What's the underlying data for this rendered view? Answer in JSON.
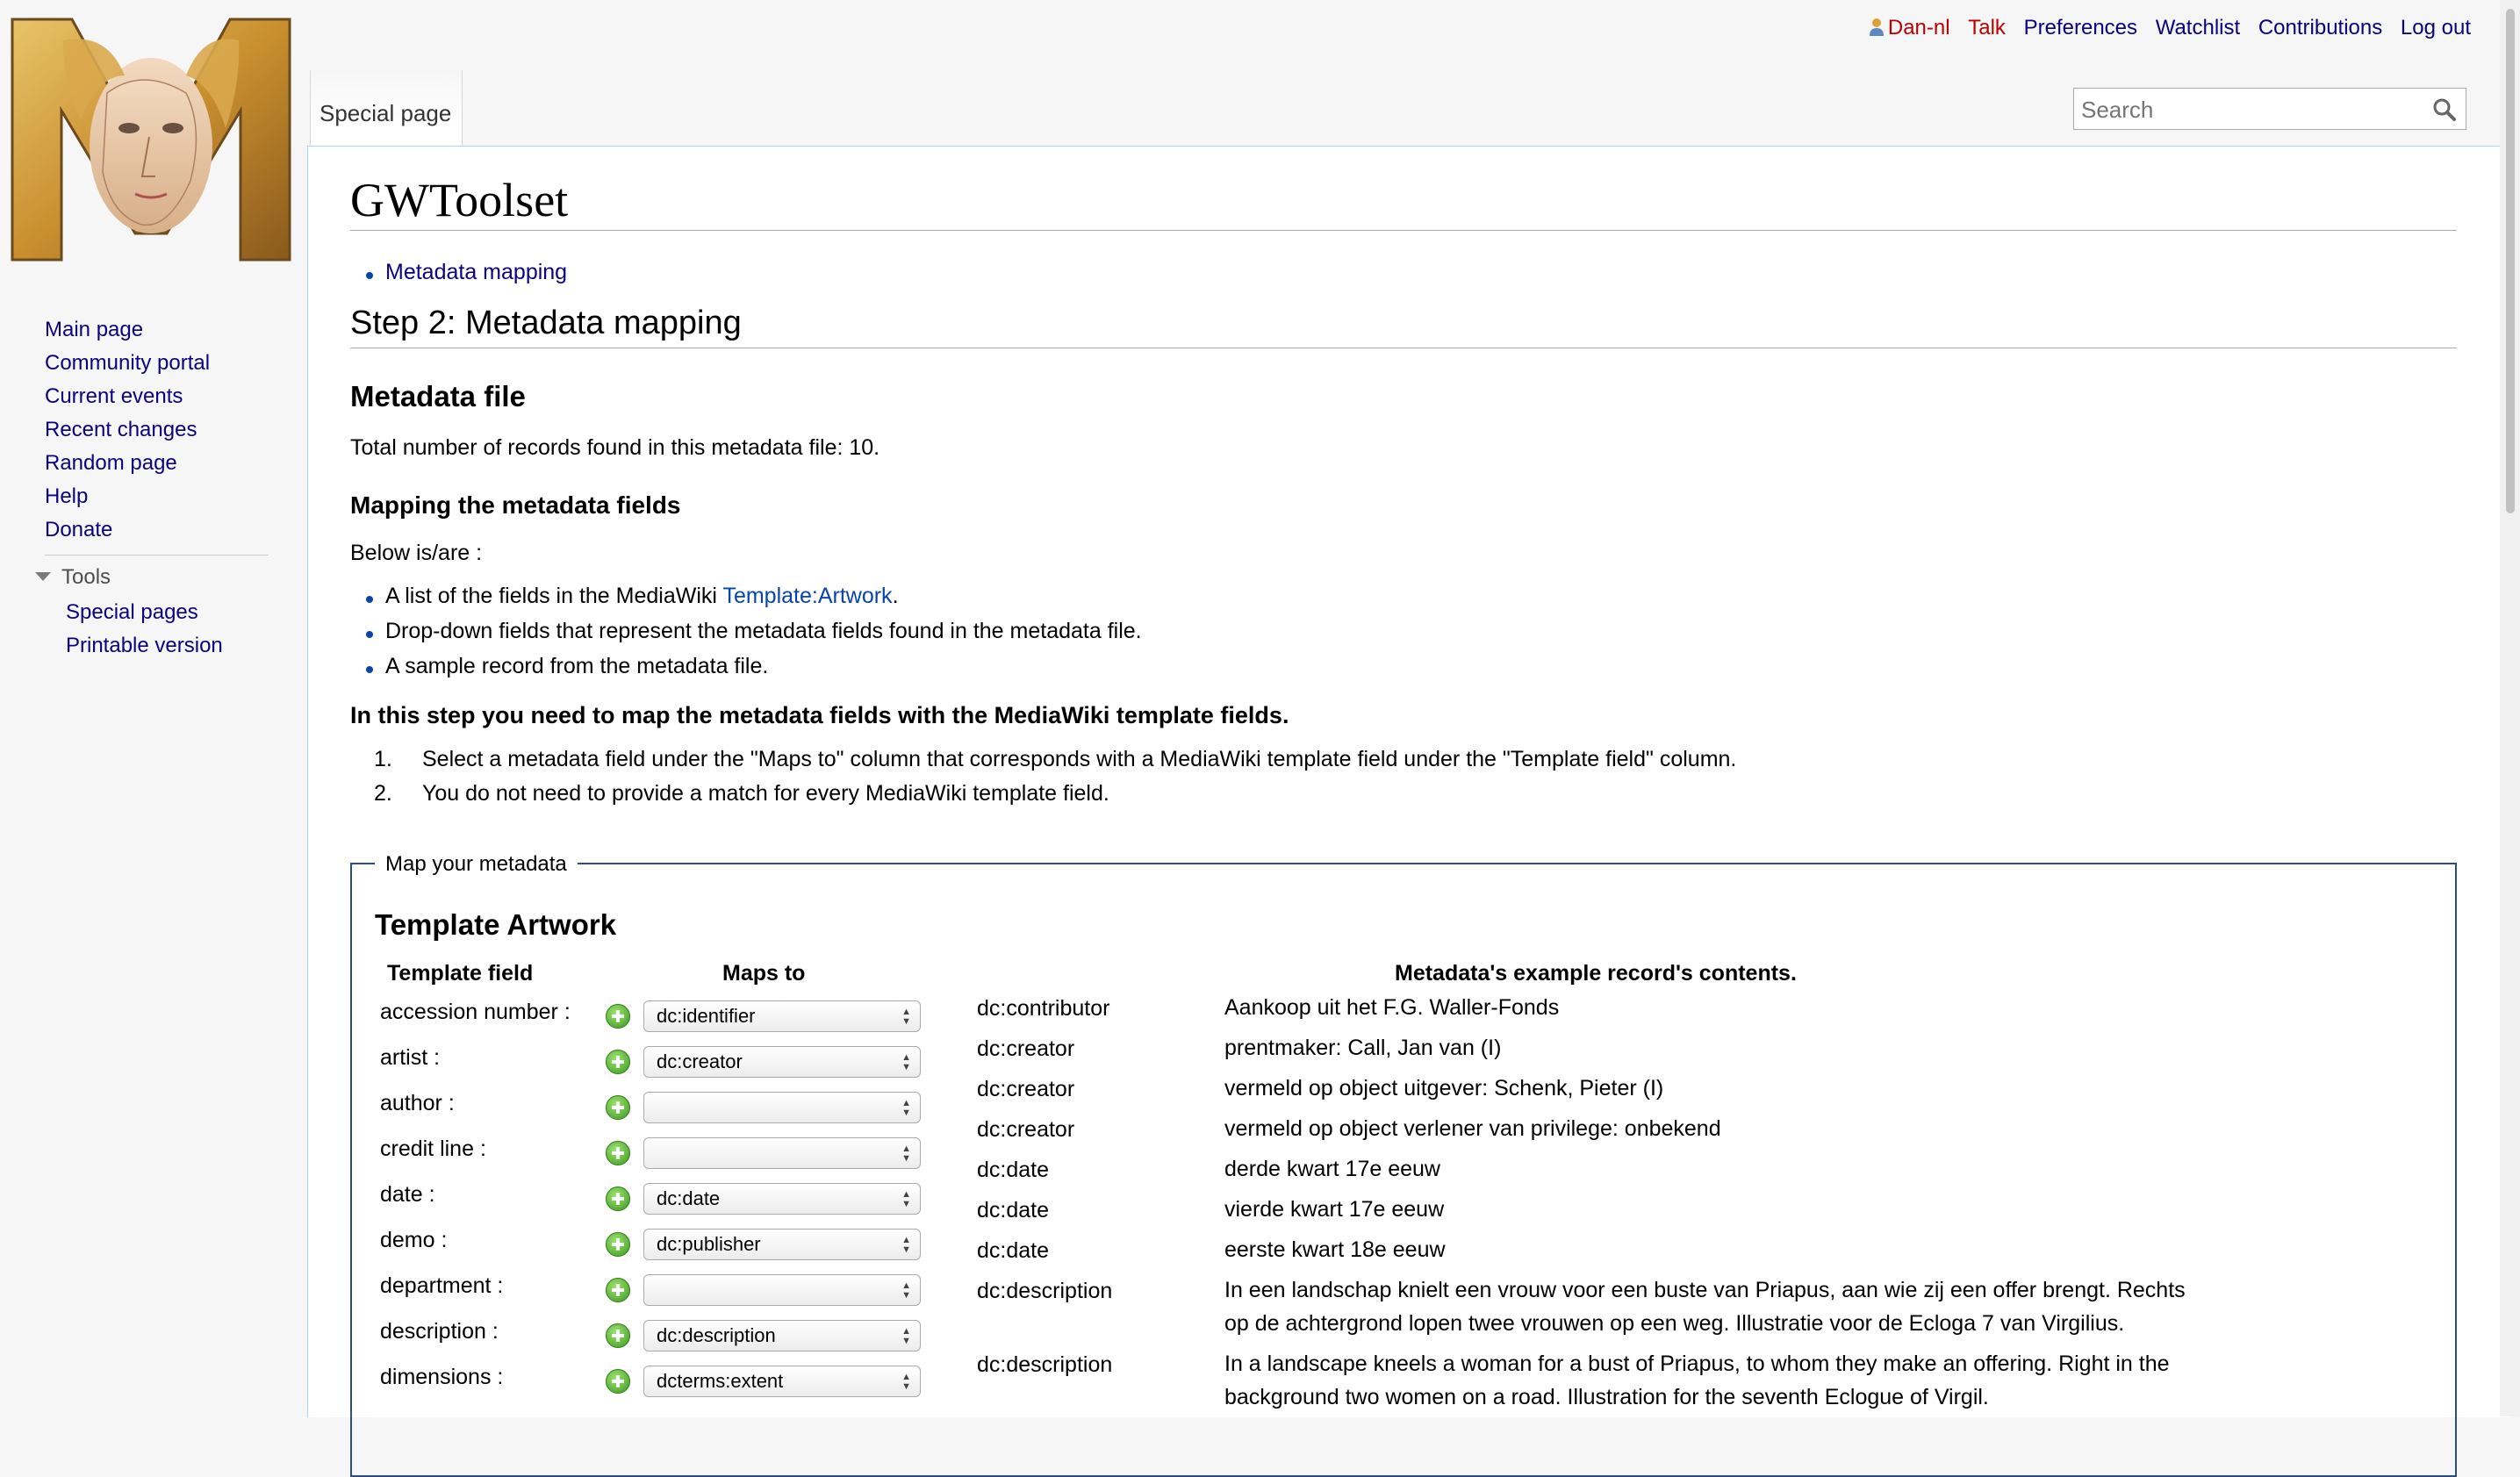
{
  "personal_tools": {
    "user": "Dan-nl",
    "talk": "Talk",
    "preferences": "Preferences",
    "watchlist": "Watchlist",
    "contributions": "Contributions",
    "logout": "Log out"
  },
  "tabs": {
    "special_page": "Special page"
  },
  "search": {
    "placeholder": "Search"
  },
  "sidebar": {
    "navigation": [
      "Main page",
      "Community portal",
      "Current events",
      "Recent changes",
      "Random page",
      "Help",
      "Donate"
    ],
    "tools_heading": "Tools",
    "tools": [
      "Special pages",
      "Printable version"
    ]
  },
  "page": {
    "title": "GWToolset",
    "breadcrumb_link": "Metadata mapping",
    "step_heading": "Step 2: Metadata mapping",
    "metadata_file_heading": "Metadata file",
    "records_text": "Total number of records found in this metadata file: 10.",
    "mapping_heading": "Mapping the metadata fields",
    "below_text": "Below is/are :",
    "bullet1_prefix": "A list of the fields in the MediaWiki ",
    "bullet1_link": "Template:Artwork",
    "bullet1_suffix": ".",
    "bullet2": "Drop-down fields that represent the metadata fields found in the metadata file.",
    "bullet3": "A sample record from the metadata file.",
    "instruction_bold": "In this step you need to map the metadata fields with the MediaWiki template fields.",
    "step1": "Select a metadata field under the \"Maps to\" column that corresponds with a MediaWiki template field under the \"Template field\" column.",
    "step2": "You do not need to provide a match for every MediaWiki template field.",
    "step1_num": "1.",
    "step2_num": "2."
  },
  "mapping": {
    "legend": "Map your metadata",
    "template_title": "Template Artwork",
    "col_template_field": "Template field",
    "col_maps_to": "Maps to",
    "col_example": "Metadata's example record's contents.",
    "rows": [
      {
        "field": "accession number :",
        "maps_to": "dc:identifier"
      },
      {
        "field": "artist :",
        "maps_to": "dc:creator"
      },
      {
        "field": "author :",
        "maps_to": ""
      },
      {
        "field": "credit line :",
        "maps_to": ""
      },
      {
        "field": "date :",
        "maps_to": "dc:date"
      },
      {
        "field": "demo :",
        "maps_to": "dc:publisher"
      },
      {
        "field": "department :",
        "maps_to": ""
      },
      {
        "field": "description :",
        "maps_to": "dc:description"
      },
      {
        "field": "dimensions :",
        "maps_to": "dcterms:extent"
      }
    ],
    "sample": [
      {
        "key": "dc:contributor",
        "value": "Aankoop uit het F.G. Waller-Fonds"
      },
      {
        "key": "dc:creator",
        "value": "prentmaker: Call, Jan van (I)"
      },
      {
        "key": "dc:creator",
        "value": "vermeld op object uitgever: Schenk, Pieter (I)"
      },
      {
        "key": "dc:creator",
        "value": "vermeld op object verlener van privilege: onbekend"
      },
      {
        "key": "dc:date",
        "value": "derde kwart 17e eeuw"
      },
      {
        "key": "dc:date",
        "value": "vierde kwart 17e eeuw"
      },
      {
        "key": "dc:date",
        "value": "eerste kwart 18e eeuw"
      },
      {
        "key": "dc:description",
        "value": "In een landschap knielt een vrouw voor een buste van Priapus, aan wie zij een offer brengt. Rechts",
        "value2": "op de achtergrond lopen twee vrouwen op een weg. Illustratie voor de Ecloga 7 van Virgilius."
      },
      {
        "key": "dc:description",
        "value": "In a landscape kneels a woman for a bust of Priapus, to whom they make an offering. Right in the",
        "value2": "background two women on a road. Illustration for the seventh Eclogue of Virgil."
      }
    ]
  },
  "colors": {
    "link": "#0b0080",
    "link_new": "#ba0000",
    "border": "#a7d7f9",
    "fieldset": "#2a4b8d"
  }
}
